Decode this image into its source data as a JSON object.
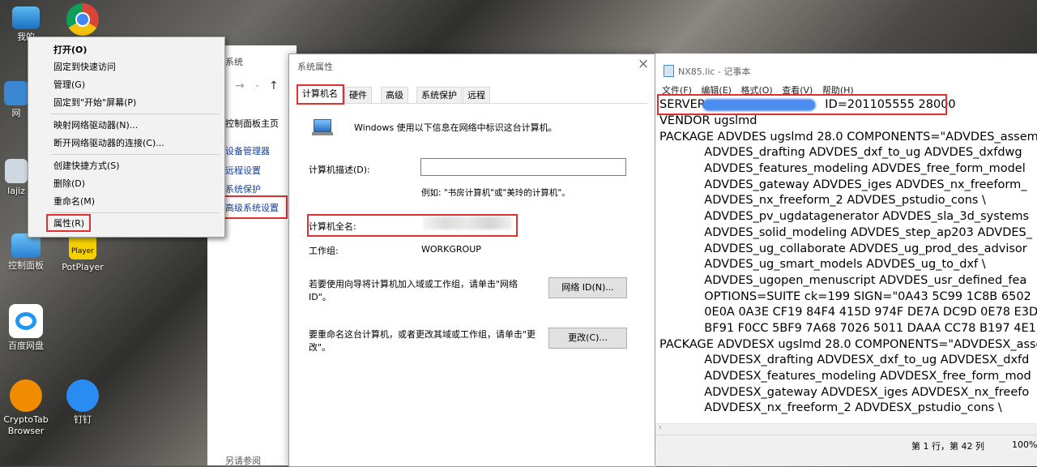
{
  "desktop_icons": [
    {
      "label": "我的"
    },
    {
      "label": "网"
    },
    {
      "label": "lajiz"
    },
    {
      "label": "控制面板"
    },
    {
      "label": "PotPlayer"
    },
    {
      "label": "百度网盘"
    },
    {
      "label": "CryptoTab Browser"
    },
    {
      "label": "钉钉"
    }
  ],
  "context_menu": {
    "items": [
      {
        "label": "打开(O)"
      },
      {
        "label": "固定到快速访问"
      },
      {
        "label": "管理(G)"
      },
      {
        "label": "固定到\"开始\"屏幕(P)"
      },
      {
        "label": "映射网络驱动器(N)..."
      },
      {
        "label": "断开网络驱动器的连接(C)..."
      },
      {
        "label": "创建快捷方式(S)"
      },
      {
        "label": "删除(D)"
      },
      {
        "label": "重命名(M)"
      },
      {
        "label": "属性(R)"
      }
    ]
  },
  "explorer": {
    "title": "系统",
    "home_link": "控制面板主页",
    "links": [
      "设备管理器",
      "远程设置",
      "系统保护",
      "高级系统设置"
    ],
    "see_also": "另请参阅"
  },
  "dialog": {
    "title": "系统属性",
    "close": "×",
    "tabs": [
      "计算机名",
      "硬件",
      "高级",
      "系统保护",
      "远程"
    ],
    "intro": "Windows 使用以下信息在网络中标识这台计算机。",
    "desc_label": "计算机描述(D):",
    "desc_value": "",
    "example": "例如: \"书房计算机\"或\"美玲的计算机\"。",
    "fullname_label": "计算机全名:",
    "workgroup_label": "工作组:",
    "workgroup_value": "WORKGROUP",
    "network_text": "若要使用向导将计算机加入域或工作组，请单击\"网络 ID\"。",
    "network_button": "网络 ID(N)...",
    "rename_text": "要重命名这台计算机，或者更改其域或工作组，请单击\"更改\"。",
    "change_button": "更改(C)..."
  },
  "notepad": {
    "title": "NX85.lic - 记事本",
    "menu": [
      "文件(F)",
      "编辑(E)",
      "格式(O)",
      "查看(V)",
      "帮助(H)"
    ],
    "lines": [
      "SERVER                                ID=201105555 28000",
      "VENDOR ugslmd",
      "PACKAGE ADVDES ugslmd 28.0 COMPONENTS=\"ADVDES_assem",
      "            ADVDES_drafting ADVDES_dxf_to_ug ADVDES_dxfdwg",
      "            ADVDES_features_modeling ADVDES_free_form_model",
      "            ADVDES_gateway ADVDES_iges ADVDES_nx_freeform_",
      "            ADVDES_nx_freeform_2 ADVDES_pstudio_cons \\",
      "            ADVDES_pv_ugdatagenerator ADVDES_sla_3d_systems",
      "            ADVDES_solid_modeling ADVDES_step_ap203 ADVDES_",
      "            ADVDES_ug_collaborate ADVDES_ug_prod_des_advisor",
      "            ADVDES_ug_smart_models ADVDES_ug_to_dxf \\",
      "            ADVDES_ugopen_menuscript ADVDES_usr_defined_fea",
      "            OPTIONS=SUITE ck=199 SIGN=\"0A43 5C99 1C8B 6502",
      "            0E0A 0A3E CF19 84F4 415D 974F DE7A DC9D 0E78 E3D",
      "            BF91 F0CC 5BF9 7A68 7026 5011 DAAA CC78 B197 4E1",
      "PACKAGE ADVDESX ugslmd 28.0 COMPONENTS=\"ADVDESX_asse",
      "            ADVDESX_drafting ADVDESX_dxf_to_ug ADVDESX_dxfd",
      "            ADVDESX_features_modeling ADVDESX_free_form_mod",
      "            ADVDESX_gateway ADVDESX_iges ADVDESX_nx_freefo",
      "            ADVDESX_nx_freeform_2 ADVDESX_pstudio_cons \\"
    ],
    "status_pos": "第 1 行，第 42 列",
    "status_zoom": "100%"
  },
  "colors": {
    "highlight_red": "#e03030",
    "selection_blue": "#0078d7",
    "link_blue": "#1a3f96"
  }
}
